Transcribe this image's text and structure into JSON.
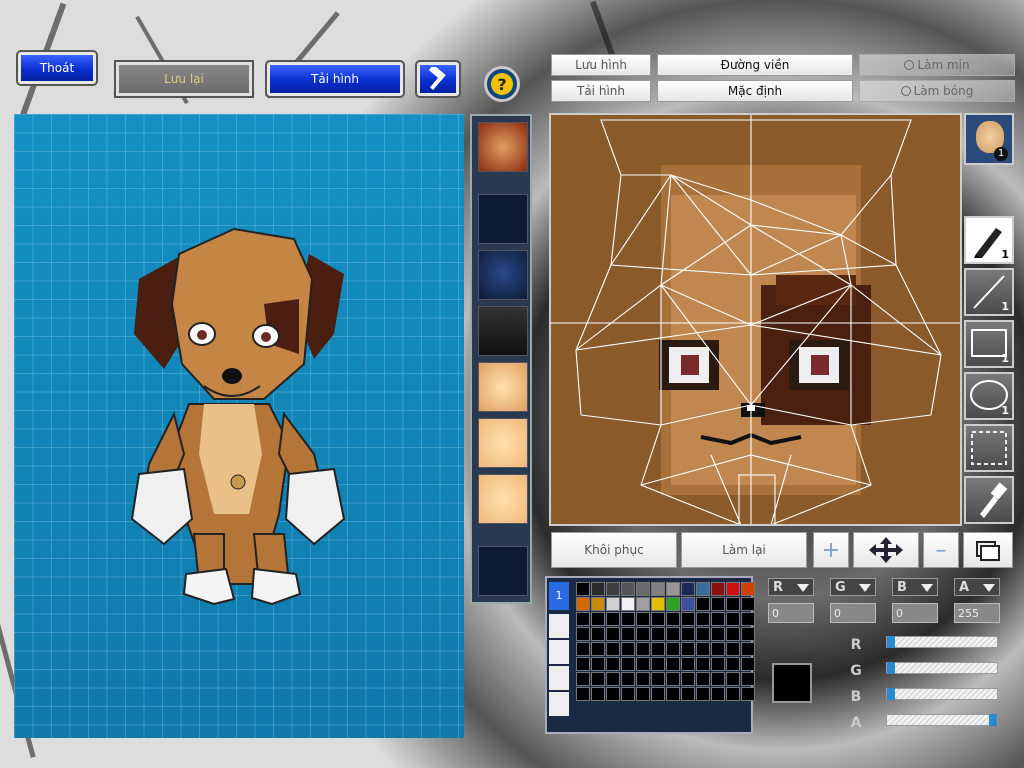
{
  "top_left": {
    "exit_label": "Thoát",
    "save_label": "Lưu lại",
    "reload_label": "Tải hình"
  },
  "top_right": {
    "save_image_label": "Lưu hình",
    "outline_label": "Đường viền",
    "smooth_label": "Làm mịn",
    "load_image_label": "Tải hình",
    "default_label": "Mặc định",
    "shade_label": "Làm bóng"
  },
  "editor_actions": {
    "restore_label": "Khôi phục",
    "redo_label": "Làm lại"
  },
  "tools": {
    "face_count": "1",
    "pen_size": "1",
    "line_size": "1",
    "rect_size": "1",
    "ellipse_size": "1"
  },
  "palette": {
    "tab_label": "1",
    "colors": [
      "#ffffff",
      "#2a2a2a",
      "#3e3e3e",
      "#555555",
      "#6a6a6a",
      "#808080",
      "#969696",
      "#1a2a55",
      "#3a6aa0",
      "#8a1010",
      "#d01010",
      "#d04000",
      "#d06a00",
      "#c88a00",
      "#d0d0d0",
      "#f0f0f0",
      "#a0a0a0",
      "#e0c000",
      "#30a020",
      "#4050a0"
    ],
    "selected_color": "#000000"
  },
  "channels": {
    "r_label": "R",
    "g_label": "G",
    "b_label": "B",
    "a_label": "A",
    "r_value": "0",
    "g_value": "0",
    "b_value": "0",
    "a_value": "255",
    "r_level": 0,
    "g_level": 0,
    "b_level": 0,
    "a_level": 1
  },
  "colors": {
    "preview_bg": "#1488bb",
    "accent_blue": "#0a2fd0",
    "skin": "#c88a48"
  }
}
